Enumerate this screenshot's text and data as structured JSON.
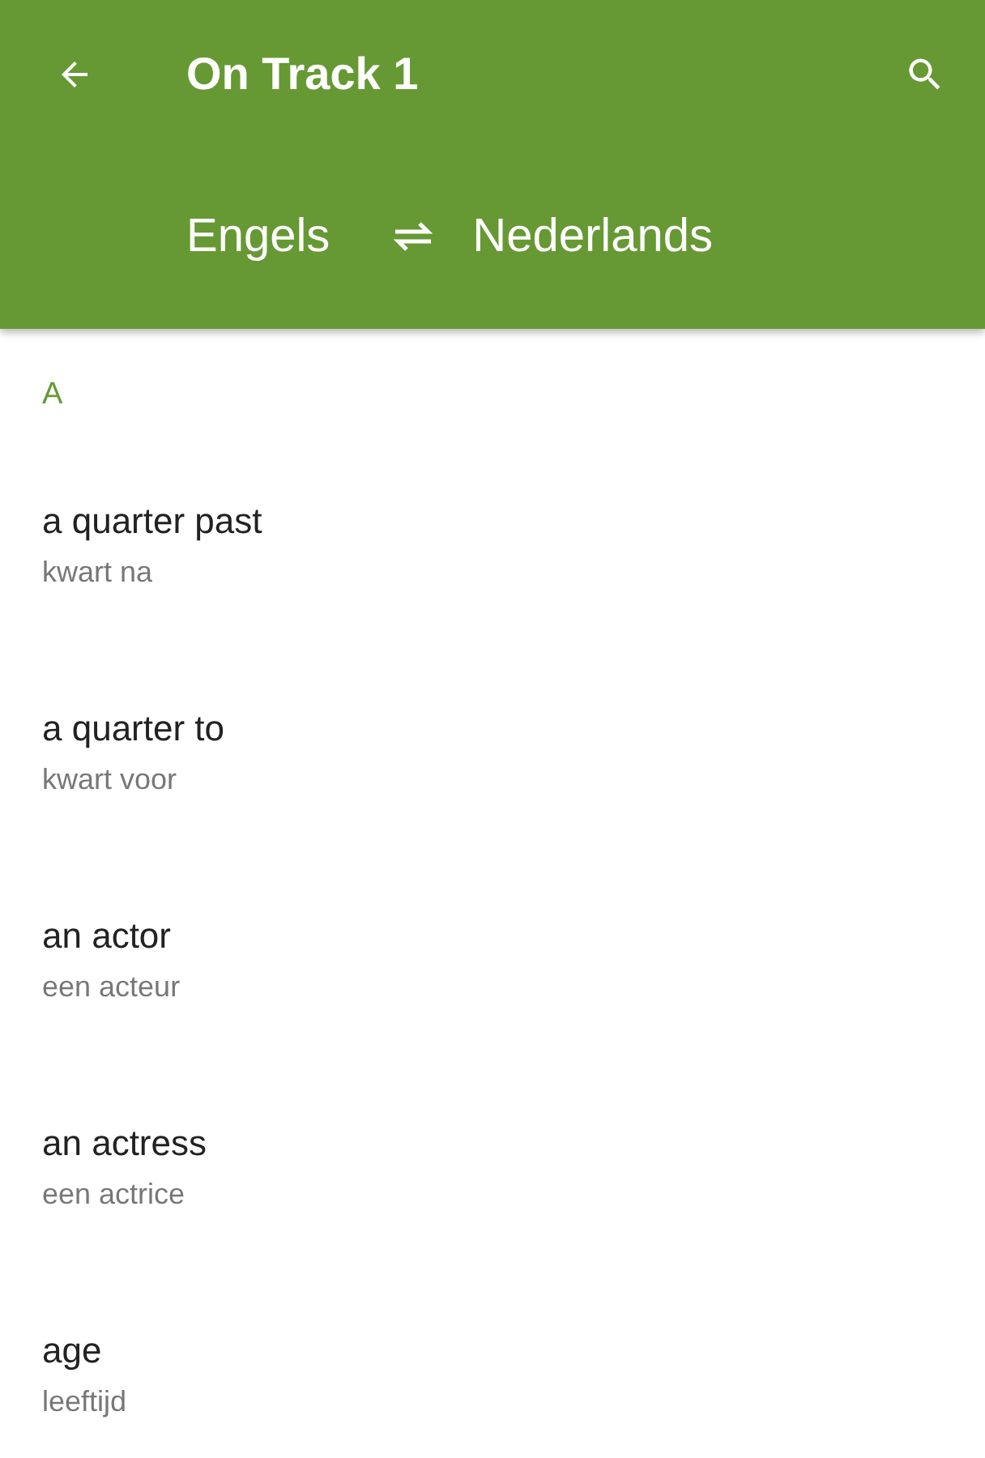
{
  "app_bar": {
    "title": "On Track 1"
  },
  "languages": {
    "source": "Engels",
    "target": "Nederlands"
  },
  "sections": [
    {
      "letter": "A",
      "entries": [
        {
          "term": "a quarter past",
          "translation": "kwart na"
        },
        {
          "term": "a quarter to",
          "translation": "kwart voor"
        },
        {
          "term": "an actor",
          "translation": "een acteur"
        },
        {
          "term": "an actress",
          "translation": "een actrice"
        },
        {
          "term": "age",
          "translation": "leeftijd"
        }
      ]
    }
  ]
}
